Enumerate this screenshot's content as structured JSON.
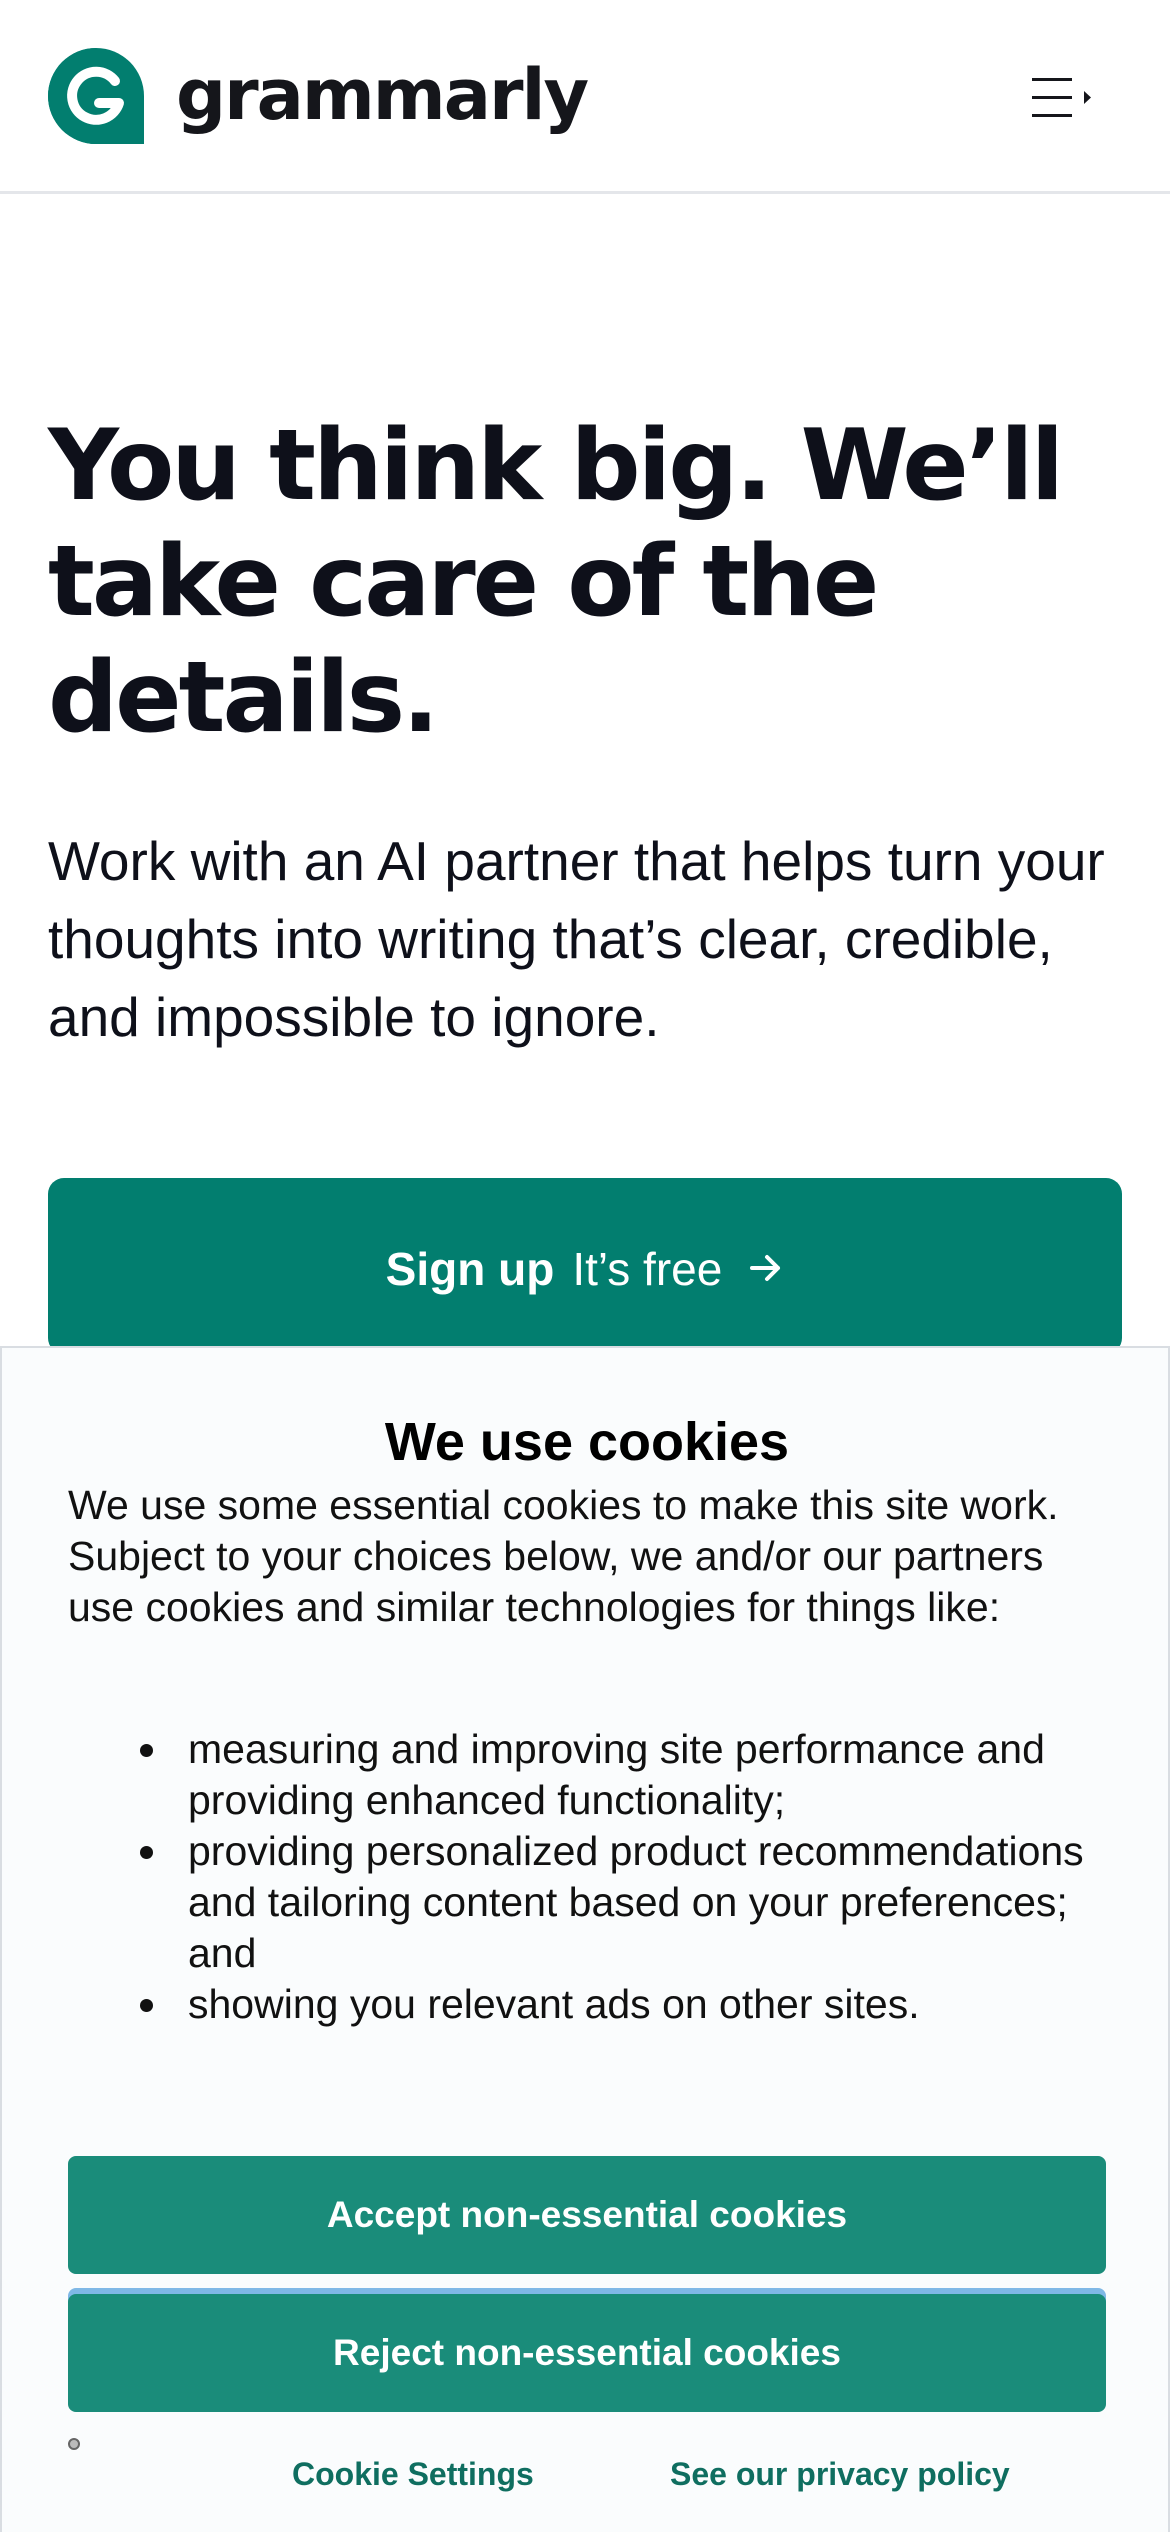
{
  "header": {
    "logo_text": "grammarly",
    "brand_color": "#027e6f",
    "menu_icon": "hamburger-menu-icon"
  },
  "hero": {
    "title": "You think big. We’ll take care of the details.",
    "subtitle": "Work with an AI partner that helps turn your thoughts into writing that’s clear, credible, and impossible to ignore.",
    "signup_label": "Sign up",
    "signup_free": "It’s free",
    "signup_icon": "arrow-right-icon"
  },
  "cookie_banner": {
    "title": "We use cookies",
    "intro": "We use some essential cookies to make this site work. Subject to your choices below, we and/or our partners use cookies and similar technologies for things like:",
    "items": [
      "measuring and improving site performance and providing enhanced functionality;",
      "providing personalized product recommendations and tailoring content based on your preferences; and",
      "showing you relevant ads on other sites."
    ],
    "accept_label": "Accept non-essential cookies",
    "reject_label": "Reject non-essential cookies",
    "settings_label": "Cookie Settings",
    "privacy_label": "See our privacy policy",
    "button_color": "#1a8c7a"
  }
}
